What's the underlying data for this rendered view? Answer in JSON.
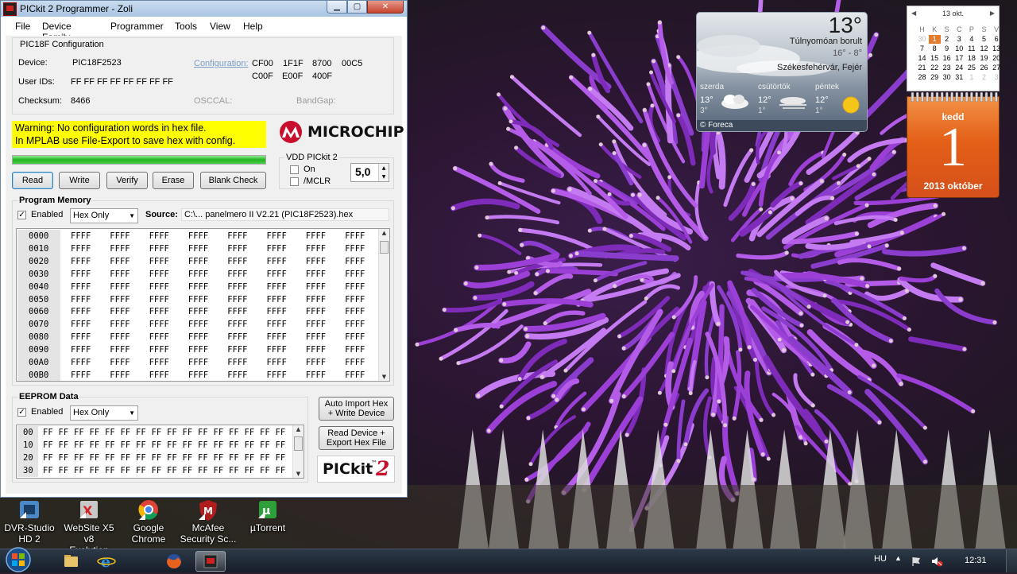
{
  "window": {
    "title": "PICkit 2 Programmer - Zoli",
    "menu": [
      "File",
      "Device Family",
      "Programmer",
      "Tools",
      "View",
      "Help"
    ]
  },
  "config": {
    "group_title": "PIC18F Configuration",
    "device_label": "Device:",
    "device_value": "PIC18F2523",
    "userids_label": "User IDs:",
    "userids_value": "FF FF FF FF FF FF FF FF",
    "checksum_label": "Checksum:",
    "checksum_value": "8466",
    "configuration_label": "Configuration:",
    "config_words": [
      "CF00",
      "1F1F",
      "8700",
      "00C5",
      "C00F",
      "E00F",
      "400F"
    ],
    "osccal_label": "OSCCAL:",
    "bandgap_label": "BandGap:"
  },
  "warning": {
    "line1": "Warning: No configuration words in hex file.",
    "line2": "In MPLAB use File-Export to save hex with config."
  },
  "progress": {
    "percent": 100,
    "color": "#21b421"
  },
  "logo_text": "MICROCHIP",
  "vdd": {
    "title": "VDD PICkit 2",
    "on_label": "On",
    "mclr_label": "/MCLR",
    "voltage": "5,0"
  },
  "actions": [
    "Read",
    "Write",
    "Verify",
    "Erase",
    "Blank Check"
  ],
  "program_memory": {
    "title": "Program Memory",
    "enabled_label": "Enabled",
    "mode": "Hex Only",
    "source_label": "Source:",
    "source_value": "C:\\... panelmero II V2.21 (PIC18F2523).hex",
    "addresses": [
      "0000",
      "0010",
      "0020",
      "0030",
      "0040",
      "0050",
      "0060",
      "0070",
      "0080",
      "0090",
      "00A0",
      "00B0"
    ],
    "word": "FFFF",
    "words_per_row": 8
  },
  "eeprom": {
    "title": "EEPROM Data",
    "enabled_label": "Enabled",
    "mode": "Hex Only",
    "addresses": [
      "00",
      "10",
      "20",
      "30"
    ],
    "byte": "FF",
    "bytes_per_row": 16
  },
  "side_buttons": {
    "auto_import": [
      "Auto Import Hex",
      "+ Write Device"
    ],
    "read_export": [
      "Read Device +",
      "Export Hex File"
    ]
  },
  "pickit_logo": {
    "text": "PICkit",
    "tm": "™",
    "num": "2"
  },
  "desktop_icons": [
    {
      "name": "dvr-studio",
      "label1": "DVR-Studio",
      "label2": "HD 2"
    },
    {
      "name": "website-x5",
      "label1": "WebSite X5 v8",
      "label2": "Evolution"
    },
    {
      "name": "google-chrome",
      "label1": "Google",
      "label2": "Chrome"
    },
    {
      "name": "mcafee",
      "label1": "McAfee",
      "label2": "Security Sc..."
    },
    {
      "name": "utorrent",
      "label1": "µTorrent",
      "label2": ""
    }
  ],
  "taskbar": {
    "language": "HU",
    "time": "12:31",
    "pinned": [
      "explorer-icon",
      "ie-icon",
      "firefox-icon",
      "pickit-icon"
    ]
  },
  "weather": {
    "temp": "13°",
    "condition": "Túlnyomóan borult",
    "range": "16° - 8°",
    "location": "Székesfehérvár, Fejér",
    "forecast": [
      {
        "day": "szerda",
        "hi": "13°",
        "lo": "3°",
        "icon": "cloudy-icon"
      },
      {
        "day": "csütörtök",
        "hi": "12°",
        "lo": "1°",
        "icon": "fog-icon"
      },
      {
        "day": "péntek",
        "hi": "12°",
        "lo": "1°",
        "icon": "sun-icon"
      }
    ],
    "footer": "© Foreca"
  },
  "calendar": {
    "title": "13 okt.",
    "headers": [
      "H",
      "K",
      "S",
      "C",
      "P",
      "S",
      "V"
    ],
    "rows": [
      [
        "30",
        "1",
        "2",
        "3",
        "4",
        "5",
        "6"
      ],
      [
        "7",
        "8",
        "9",
        "10",
        "11",
        "12",
        "13"
      ],
      [
        "14",
        "15",
        "16",
        "17",
        "18",
        "19",
        "20"
      ],
      [
        "21",
        "22",
        "23",
        "24",
        "25",
        "26",
        "27"
      ],
      [
        "28",
        "29",
        "30",
        "31",
        "1",
        "2",
        "3"
      ]
    ],
    "today_row": 0,
    "today_col": 1,
    "day_name": "kedd",
    "day_number": "1",
    "month_year": "2013 október",
    "accent": "#e45f17"
  }
}
